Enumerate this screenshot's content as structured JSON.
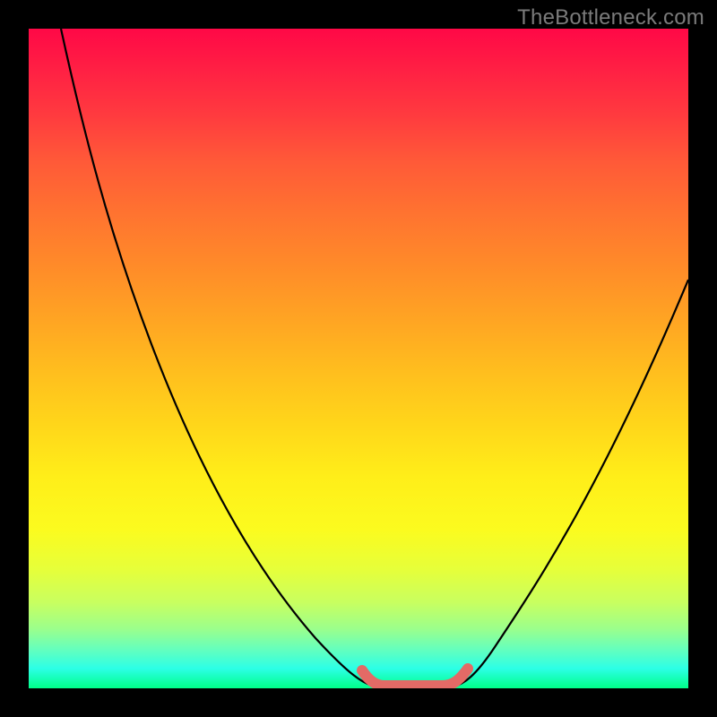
{
  "watermark": "TheBottleneck.com",
  "colors": {
    "frame": "#000000",
    "gradient_top": "#ff0846",
    "gradient_bottom": "#00ff89",
    "curve": "#000000",
    "highlight": "#e36a66"
  },
  "chart_data": {
    "type": "line",
    "title": "",
    "xlabel": "",
    "ylabel": "",
    "xlim": [
      0,
      100
    ],
    "ylim": [
      0,
      100
    ],
    "grid": false,
    "series": [
      {
        "name": "bottleneck-curve",
        "x": [
          5,
          10,
          15,
          20,
          25,
          30,
          35,
          40,
          45,
          50,
          53,
          55,
          58,
          60,
          62,
          65,
          70,
          75,
          80,
          85,
          90,
          95,
          100
        ],
        "y": [
          100,
          92,
          83,
          74,
          65,
          56,
          47,
          38,
          28,
          17,
          8,
          2,
          0,
          0,
          0,
          2,
          9,
          18,
          27,
          36,
          44,
          53,
          62
        ]
      },
      {
        "name": "optimal-range-highlight",
        "x": [
          53,
          55,
          58,
          60,
          62,
          65
        ],
        "y": [
          8,
          2,
          0,
          0,
          0,
          2
        ]
      }
    ],
    "annotations": []
  }
}
